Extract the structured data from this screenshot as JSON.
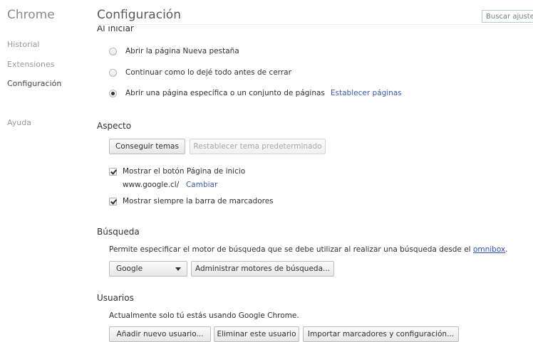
{
  "sidebar": {
    "brand": "Chrome",
    "items": [
      {
        "label": "Historial"
      },
      {
        "label": "Extensiones"
      },
      {
        "label": "Configuración"
      },
      {
        "label": "Ayuda"
      }
    ]
  },
  "header": {
    "title": "Configuración",
    "search_placeholder": "Buscar ajustes"
  },
  "startup": {
    "heading_cut": "Al iniciar",
    "options": [
      {
        "label": "Abrir la página Nueva pestaña",
        "checked": false
      },
      {
        "label": "Continuar como lo dejé todo antes de cerrar",
        "checked": false
      },
      {
        "label": "Abrir una página específica o un conjunto de páginas",
        "checked": true,
        "link": "Establecer páginas"
      }
    ]
  },
  "appearance": {
    "heading": "Aspecto",
    "get_themes": "Conseguir temas",
    "reset_theme": "Restablecer tema predeterminado",
    "show_home": "Mostrar el botón Página de inicio",
    "home_url": "www.google.cl/",
    "change": "Cambiar",
    "show_bookmarks": "Mostrar siempre la barra de marcadores"
  },
  "search": {
    "heading": "Búsqueda",
    "description": "Permite especificar el motor de búsqueda que se debe utilizar al realizar una búsqueda desde el",
    "omnibox": "omnibox",
    "period": ".",
    "engine_selected": "Google",
    "manage": "Administrar motores de búsqueda..."
  },
  "users": {
    "heading": "Usuarios",
    "description": "Actualmente solo tú estás usando Google Chrome.",
    "add": "Añadir nuevo usuario...",
    "remove": "Eliminar este usuario",
    "import": "Importar marcadores y configuración..."
  }
}
